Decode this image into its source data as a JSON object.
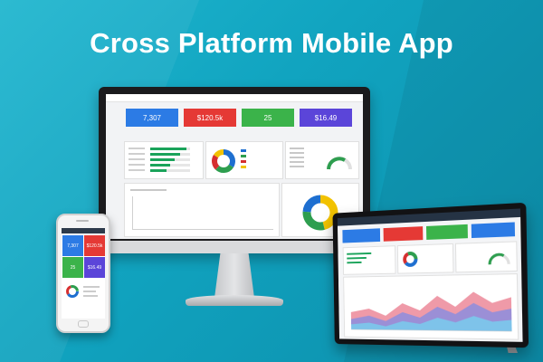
{
  "headline": "Cross Platform Mobile App",
  "colors": {
    "background": "#1ab0cb",
    "tile_blue": "#2c7be5",
    "tile_red": "#e53935",
    "tile_green": "#3bb34a",
    "tile_purple": "#5b45d9",
    "donut_green": "#2e9e4f",
    "donut_blue": "#1e6fd0",
    "donut_red": "#d62f2f",
    "donut_yellow": "#f2c200"
  },
  "monitor": {
    "stat_tiles": [
      {
        "value": "7,307",
        "color": "#2c7be5"
      },
      {
        "value": "$120.5k",
        "color": "#e53935"
      },
      {
        "value": "25",
        "color": "#3bb34a"
      },
      {
        "value": "$16.49",
        "color": "#5b45d9"
      }
    ],
    "donut_slices": [
      {
        "share": 0.34,
        "color": "#1e6fd0"
      },
      {
        "share": 0.28,
        "color": "#2e9e4f"
      },
      {
        "share": 0.22,
        "color": "#d62f2f"
      },
      {
        "share": 0.16,
        "color": "#f2c200"
      }
    ],
    "big_donut_slices": [
      {
        "share": 0.46,
        "color": "#f2c200"
      },
      {
        "share": 0.3,
        "color": "#2e9e4f"
      },
      {
        "share": 0.24,
        "color": "#1e6fd0"
      }
    ],
    "progress_bars": [
      0.9,
      0.75,
      0.62,
      0.5,
      0.4
    ]
  },
  "phone": {
    "tile_values": [
      "7,307",
      "$120.5k",
      "25",
      "$16.49"
    ]
  },
  "tablet": {
    "tile_colors": [
      "#2c7be5",
      "#e53935",
      "#3bb34a",
      "#2c7be5"
    ]
  }
}
